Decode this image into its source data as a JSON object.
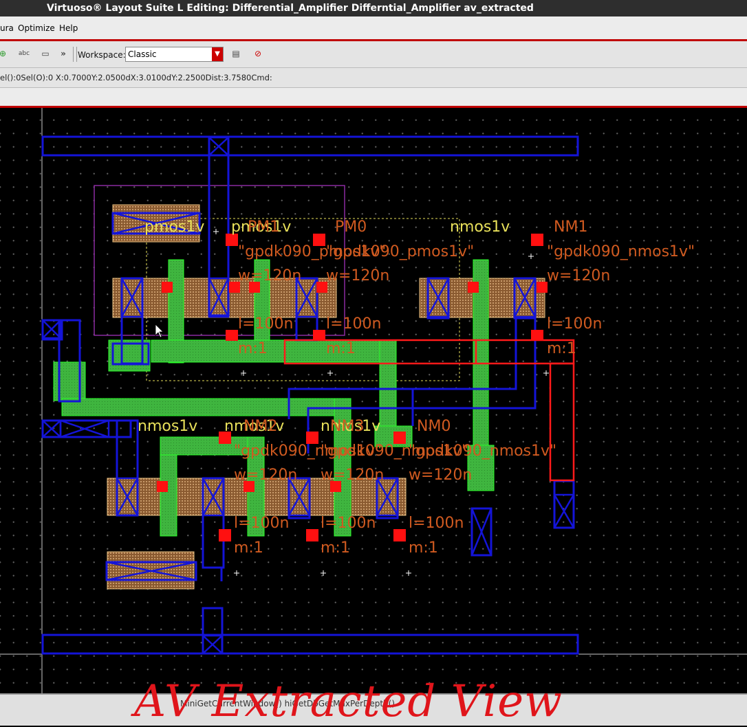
{
  "window": {
    "title": "Virtuoso® Layout Suite L Editing: Differential_Amplifier Differntial_Amplifier av_extracted"
  },
  "menu": {
    "items": [
      "ura",
      "Optimize",
      "Help"
    ]
  },
  "toolbar": {
    "workspace_label": "Workspace:",
    "workspace_value": "Classic",
    "icons": [
      "add-icon",
      "abc-label-icon",
      "plug-icon",
      "more-icon",
      "workspace-save-icon",
      "workspace-delete-icon"
    ],
    "more_label": "»",
    "abc_label": "abc"
  },
  "status": {
    "text": "el():0Sel(O):0   X:0.7000Y:2.0500dX:3.0100dY:2.2500Dist:3.7580Cmd:"
  },
  "bottom": {
    "command": "MiniGetCurrentWindow()  hiGetDbGetMaxPerDepth()"
  },
  "watermark": "AV Extracted View",
  "layout": {
    "labels": {
      "pmos1": "pmos1v",
      "pmos2": "pmos1v",
      "pm1": "PM1",
      "pm0": "PM0",
      "gpdk_pmos_a": "\"gpdk090_pmos1v\"",
      "gpdk_pmos_b": "\"gpdk090_pmos1v\"",
      "w_p1": "w=120n",
      "w_p2": "w=120n",
      "l_p1": "l=100n",
      "l_p2": "l=100n",
      "m_p1": "m:1",
      "m_p2": "m:1",
      "nmos_top": "nmos1v",
      "nm1": "NM1",
      "gpdk_nmos_top": "\"gpdk090_nmos1v\"",
      "w_n1": "w=120n",
      "l_n1": "l=100n",
      "m_n1": "m:1",
      "nmos_b1": "nmos1v",
      "nmos_b2": "nmos1v",
      "nmos_b3": "nmos1v",
      "nm2": "NM2",
      "nm3": "NM3",
      "nm0": "NM0",
      "gpdk_b1": "\"gpdk090_nmos1v\"",
      "gpdk_b2": "\"gpdk090_nmos1v\"",
      "gpdk_b3": "\"gpdk090_nmos1v\"",
      "w_b1": "w=120n",
      "w_b2": "w=120n",
      "w_b3": "w=120n",
      "l_b1": "l=100n",
      "l_b2": "l=100n",
      "l_b3": "l=100n",
      "m_b1": "m:1",
      "m_b2": "m:1",
      "m_b3": "m:1"
    },
    "colors": {
      "metal1": "#1414d8",
      "poly": "#3fb53f",
      "diffusion": "#c89a6a",
      "pin": "#ff1010",
      "selection": "#ff1a1a",
      "instance_label": "#d05a20",
      "cell_label": "#e8e05a",
      "nwell": "#8a2aa0"
    }
  }
}
